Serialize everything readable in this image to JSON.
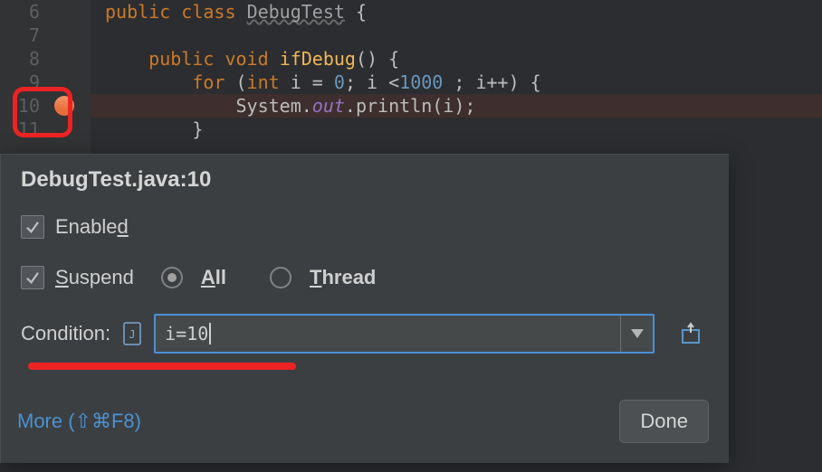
{
  "editor": {
    "lines": [
      {
        "num": "6",
        "raw_html": "<span class='kw'>public</span> <span class='kw'>class</span> <span class='cls'>DebugTest</span> <span class='pln'>{</span>"
      },
      {
        "num": "7",
        "raw_html": ""
      },
      {
        "num": "8",
        "raw_html": "    <span class='kw'>public</span> <span class='kw'>void</span> <span class='mth'>ifDebug</span><span class='pln'>() {</span>"
      },
      {
        "num": "9",
        "raw_html": "        <span class='kw'>for</span> <span class='pln'>(</span><span class='kw'>int</span> <span class='pln'>i = </span><span class='num'>0</span><span class='pln'>; i &lt;</span><span class='num'>1000</span><span class='pln'> ; i++) {</span>"
      },
      {
        "num": "10",
        "raw_html": "            <span class='pln'>System.</span><span class='field'>out</span><span class='pln'>.println(i);</span>",
        "highlight": true,
        "breakpoint": true
      },
      {
        "num": "11",
        "raw_html": "        <span class='pln'>}</span>"
      }
    ]
  },
  "dialog": {
    "title": "DebugTest.java:10",
    "enabled_label": "Enabled",
    "suspend_label": "Suspend",
    "radio_all": "All",
    "radio_thread": "Thread",
    "condition_label": "Condition:",
    "condition_value": "i=10",
    "more_label": "More (⇧⌘F8)",
    "done_label": "Done"
  }
}
